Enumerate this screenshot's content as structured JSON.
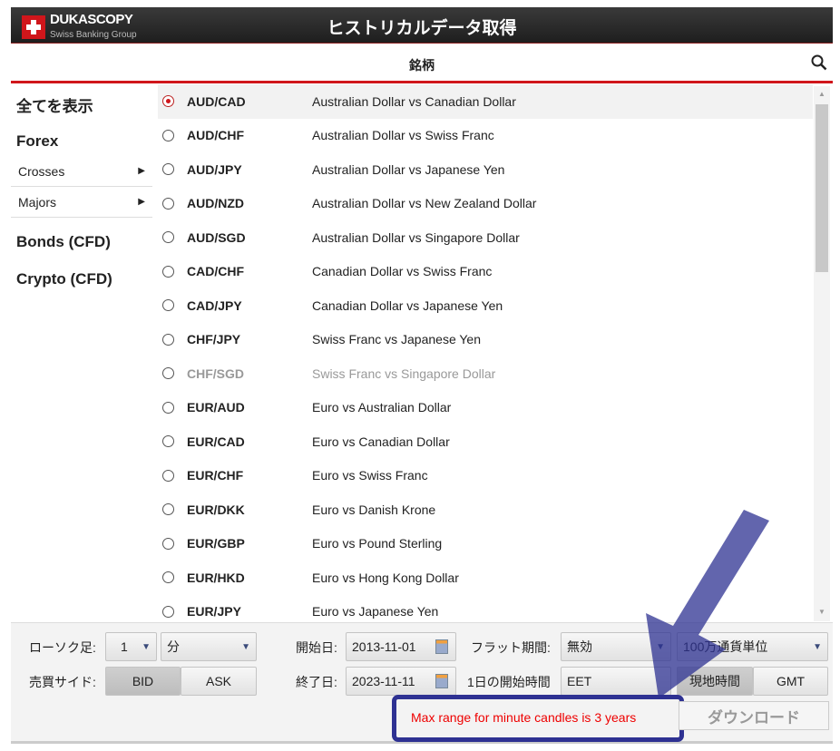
{
  "header": {
    "brand": "DUKASCOPY",
    "brand_sub": "Swiss Banking Group",
    "title": "ヒストリカルデータ取得"
  },
  "subheader": {
    "title": "銘柄"
  },
  "sidebar": {
    "all": "全てを表示",
    "forex": "Forex",
    "crosses": "Crosses",
    "majors": "Majors",
    "bonds": "Bonds (CFD)",
    "crypto": "Crypto (CFD)"
  },
  "instruments": [
    {
      "code": "AUD/CAD",
      "name": "Australian Dollar vs Canadian Dollar",
      "selected": true
    },
    {
      "code": "AUD/CHF",
      "name": "Australian Dollar vs Swiss Franc"
    },
    {
      "code": "AUD/JPY",
      "name": "Australian Dollar vs Japanese Yen"
    },
    {
      "code": "AUD/NZD",
      "name": "Australian Dollar vs New Zealand Dollar"
    },
    {
      "code": "AUD/SGD",
      "name": "Australian Dollar vs Singapore Dollar"
    },
    {
      "code": "CAD/CHF",
      "name": "Canadian Dollar vs Swiss Franc"
    },
    {
      "code": "CAD/JPY",
      "name": "Canadian Dollar vs Japanese Yen"
    },
    {
      "code": "CHF/JPY",
      "name": "Swiss Franc vs Japanese Yen"
    },
    {
      "code": "CHF/SGD",
      "name": "Swiss Franc vs Singapore Dollar",
      "disabled": true
    },
    {
      "code": "EUR/AUD",
      "name": "Euro vs Australian Dollar"
    },
    {
      "code": "EUR/CAD",
      "name": "Euro vs Canadian Dollar"
    },
    {
      "code": "EUR/CHF",
      "name": "Euro vs Swiss Franc"
    },
    {
      "code": "EUR/DKK",
      "name": "Euro vs Danish Krone"
    },
    {
      "code": "EUR/GBP",
      "name": "Euro vs Pound Sterling"
    },
    {
      "code": "EUR/HKD",
      "name": "Euro vs Hong Kong Dollar"
    },
    {
      "code": "EUR/JPY",
      "name": "Euro vs Japanese Yen"
    }
  ],
  "controls": {
    "candle_label": "ローソク足:",
    "candle_value": "1",
    "candle_unit": "分",
    "side_label": "売買サイド:",
    "bid": "BID",
    "ask": "ASK",
    "start_label": "開始日:",
    "start_date": "2013-11-01",
    "end_label": "終了日:",
    "end_date": "2023-11-11",
    "flat_label": "フラット期間:",
    "flat_value": "無効",
    "volume_unit": "100万通貨単位",
    "day_start_label": "1日の開始時間",
    "day_start_value": "EET",
    "local_time": "現地時間",
    "gmt": "GMT",
    "message": "Max range for minute candles is 3 years",
    "download": "ダウンロード"
  },
  "colors": {
    "accent": "#d0161b",
    "annotation": "#2e3192"
  }
}
